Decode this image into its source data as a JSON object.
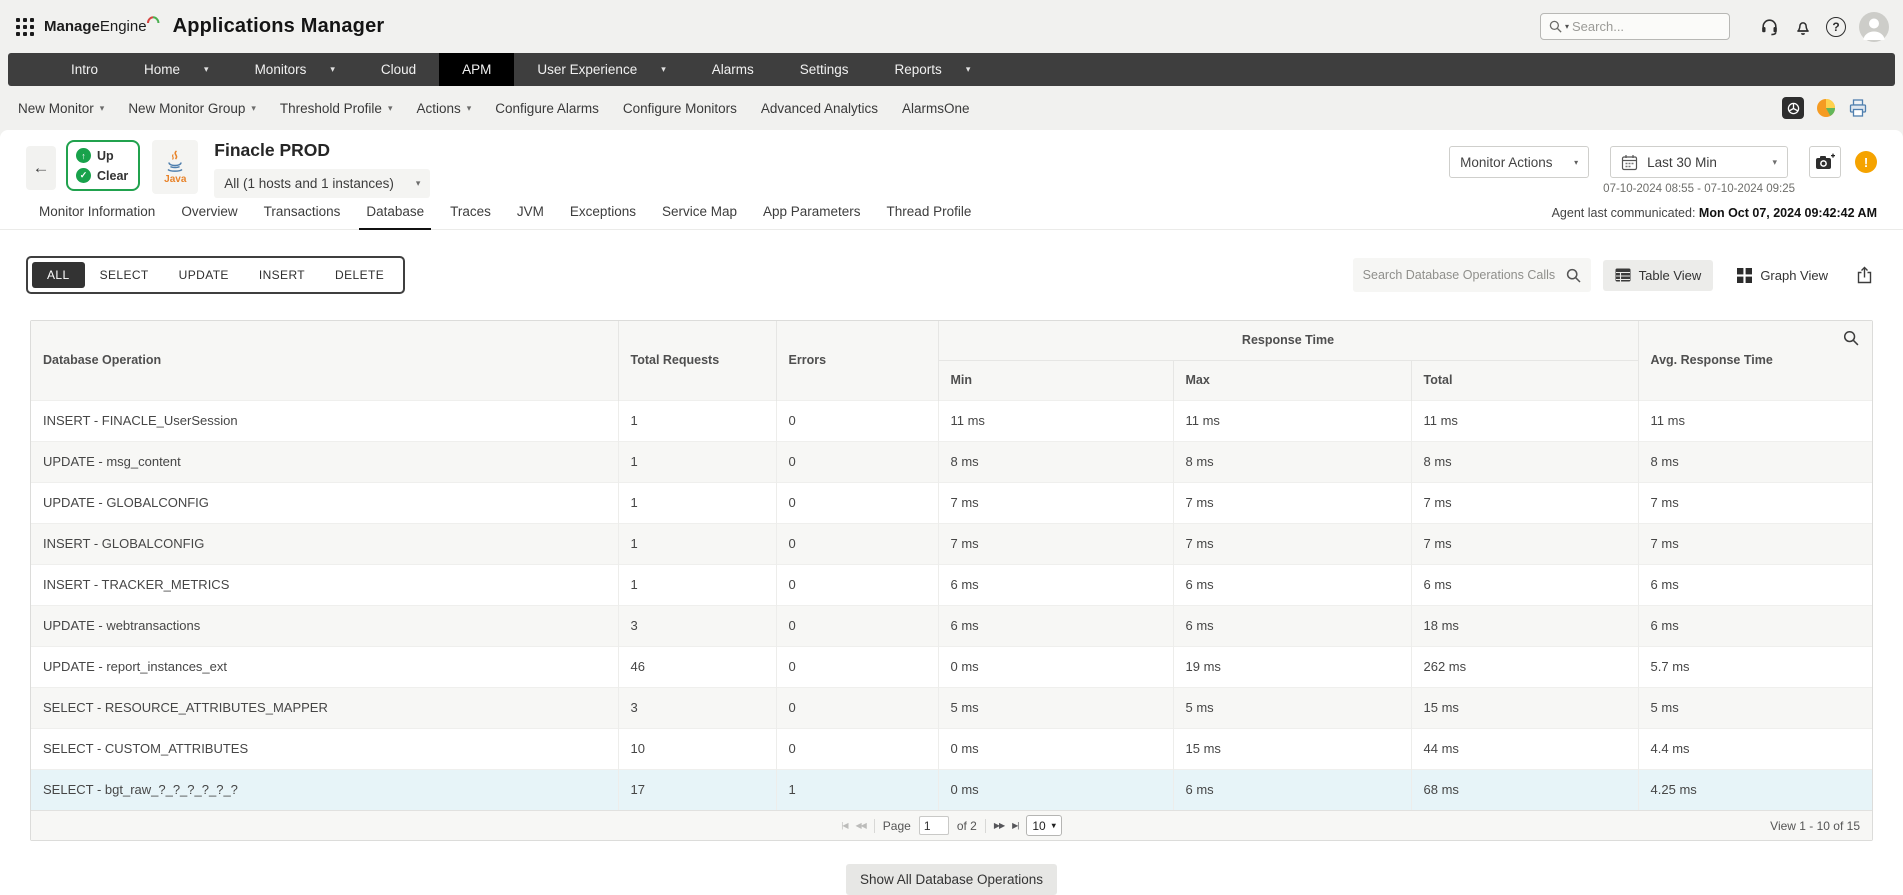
{
  "colors": {
    "accent_green": "#21a24e",
    "alert_orange": "#f5a300",
    "nav_bg": "#3e3e3e",
    "nav_active": "#000000",
    "row_highlight": "#e7f4f8"
  },
  "header": {
    "brand_bold": "Manage",
    "brand_light": "Engine",
    "app_title": "Applications Manager",
    "search_placeholder": "Search..."
  },
  "nav": {
    "active": "APM",
    "items": [
      {
        "label": "Intro"
      },
      {
        "label": "Home"
      },
      {
        "label": "Monitors"
      },
      {
        "label": "Cloud"
      },
      {
        "label": "APM"
      },
      {
        "label": "User Experience"
      },
      {
        "label": "Alarms"
      },
      {
        "label": "Settings"
      },
      {
        "label": "Reports"
      }
    ]
  },
  "toolbar": {
    "items": [
      {
        "label": "New Monitor"
      },
      {
        "label": "New Monitor Group"
      },
      {
        "label": "Threshold Profile"
      },
      {
        "label": "Actions"
      },
      {
        "label": "Configure Alarms"
      },
      {
        "label": "Configure Monitors"
      },
      {
        "label": "Advanced Analytics"
      },
      {
        "label": "AlarmsOne"
      }
    ]
  },
  "monitor": {
    "name": "Finacle PROD",
    "status_up": "Up",
    "status_clear": "Clear",
    "type_label": "Java",
    "scope": "All (1 hosts and 1 instances)",
    "actions_label": "Monitor Actions",
    "time_range": "Last 30 Min",
    "time_range_detail": "07-10-2024 08:55 - 07-10-2024 09:25",
    "agent_label": "Agent last communicated:",
    "agent_value": "Mon Oct 07, 2024 09:42:42 AM"
  },
  "tabs": {
    "active": "Database",
    "items": [
      "Monitor Information",
      "Overview",
      "Transactions",
      "Database",
      "Traces",
      "JVM",
      "Exceptions",
      "Service Map",
      "App Parameters",
      "Thread Profile"
    ]
  },
  "filters": {
    "active": "ALL",
    "items": [
      "ALL",
      "SELECT",
      "UPDATE",
      "INSERT",
      "DELETE"
    ]
  },
  "ops_controls": {
    "search_placeholder": "Search Database Operations Calls",
    "table_view_label": "Table View",
    "graph_view_label": "Graph View"
  },
  "table": {
    "columns": {
      "operation": "Database Operation",
      "total_requests": "Total Requests",
      "errors": "Errors",
      "response_time": "Response Time",
      "min": "Min",
      "max": "Max",
      "total": "Total",
      "avg": "Avg. Response Time"
    },
    "rows": [
      {
        "operation": "INSERT - FINACLE_UserSession",
        "total_requests": "1",
        "errors": "0",
        "min": "11 ms",
        "max": "11 ms",
        "total": "11 ms",
        "avg": "11 ms",
        "highlighted": false
      },
      {
        "operation": "UPDATE - msg_content",
        "total_requests": "1",
        "errors": "0",
        "min": "8 ms",
        "max": "8 ms",
        "total": "8 ms",
        "avg": "8 ms",
        "highlighted": false
      },
      {
        "operation": "UPDATE - GLOBALCONFIG",
        "total_requests": "1",
        "errors": "0",
        "min": "7 ms",
        "max": "7 ms",
        "total": "7 ms",
        "avg": "7 ms",
        "highlighted": false
      },
      {
        "operation": "INSERT - GLOBALCONFIG",
        "total_requests": "1",
        "errors": "0",
        "min": "7 ms",
        "max": "7 ms",
        "total": "7 ms",
        "avg": "7 ms",
        "highlighted": false
      },
      {
        "operation": "INSERT - TRACKER_METRICS",
        "total_requests": "1",
        "errors": "0",
        "min": "6 ms",
        "max": "6 ms",
        "total": "6 ms",
        "avg": "6 ms",
        "highlighted": false
      },
      {
        "operation": "UPDATE - webtransactions",
        "total_requests": "3",
        "errors": "0",
        "min": "6 ms",
        "max": "6 ms",
        "total": "18 ms",
        "avg": "6 ms",
        "highlighted": false
      },
      {
        "operation": "UPDATE - report_instances_ext",
        "total_requests": "46",
        "errors": "0",
        "min": "0 ms",
        "max": "19 ms",
        "total": "262 ms",
        "avg": "5.7 ms",
        "highlighted": false
      },
      {
        "operation": "SELECT - RESOURCE_ATTRIBUTES_MAPPER",
        "total_requests": "3",
        "errors": "0",
        "min": "5 ms",
        "max": "5 ms",
        "total": "15 ms",
        "avg": "5 ms",
        "highlighted": false
      },
      {
        "operation": "SELECT - CUSTOM_ATTRIBUTES",
        "total_requests": "10",
        "errors": "0",
        "min": "0 ms",
        "max": "15 ms",
        "total": "44 ms",
        "avg": "4.4 ms",
        "highlighted": false
      },
      {
        "operation": "SELECT - bgt_raw_?_?_?_?_?_?",
        "total_requests": "17",
        "errors": "1",
        "min": "0 ms",
        "max": "6 ms",
        "total": "68 ms",
        "avg": "4.25 ms",
        "highlighted": true
      }
    ]
  },
  "pagination": {
    "page_label": "Page",
    "page_value": "1",
    "of_label": "of 2",
    "page_size": "10",
    "view_summary": "View 1 - 10 of 15"
  },
  "footer": {
    "show_all_label": "Show All Database Operations"
  }
}
